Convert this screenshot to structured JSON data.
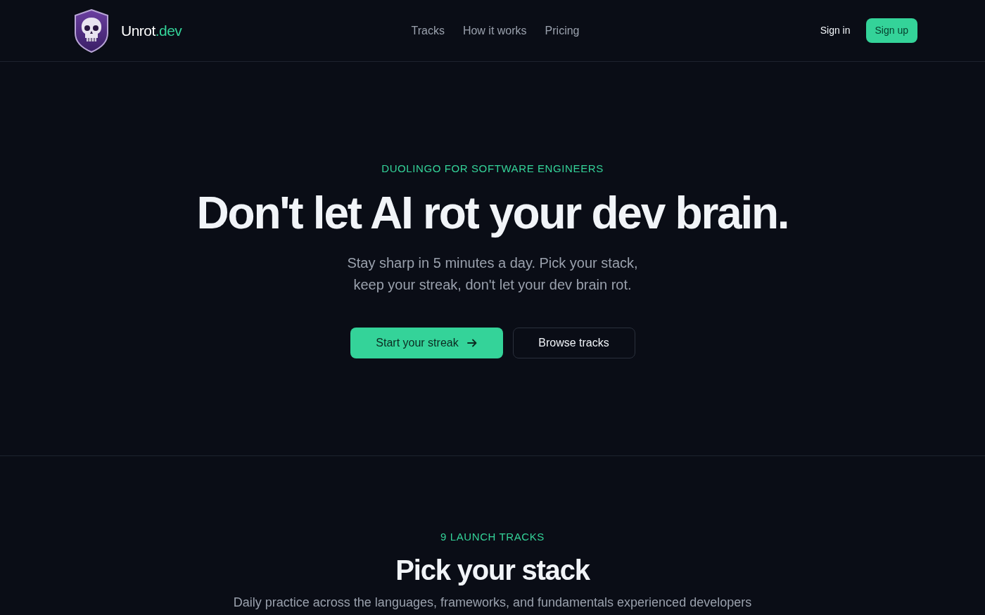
{
  "header": {
    "brand": {
      "name": "Unrot",
      "suffix": ".dev"
    },
    "nav": [
      {
        "label": "Tracks"
      },
      {
        "label": "How it works"
      },
      {
        "label": "Pricing"
      }
    ],
    "actions": [
      {
        "label": "Sign in",
        "kind": "link"
      },
      {
        "label": "Sign up",
        "kind": "primary"
      }
    ]
  },
  "hero": {
    "eyebrow": "DUOLINGO FOR SOFTWARE ENGINEERS",
    "title": "Don't let AI rot your dev brain.",
    "subtitle": "Stay sharp in 5 minutes a day. Pick your stack, keep your streak, don't let your dev brain rot.",
    "buttons": [
      {
        "label": "Start your streak",
        "kind": "primary"
      },
      {
        "label": "Browse tracks",
        "kind": "secondary"
      }
    ]
  },
  "tracks": {
    "eyebrow": "9 LAUNCH TRACKS",
    "title": "Pick your stack",
    "description": "Daily practice across the languages, frameworks, and fundamentals experienced developers"
  }
}
